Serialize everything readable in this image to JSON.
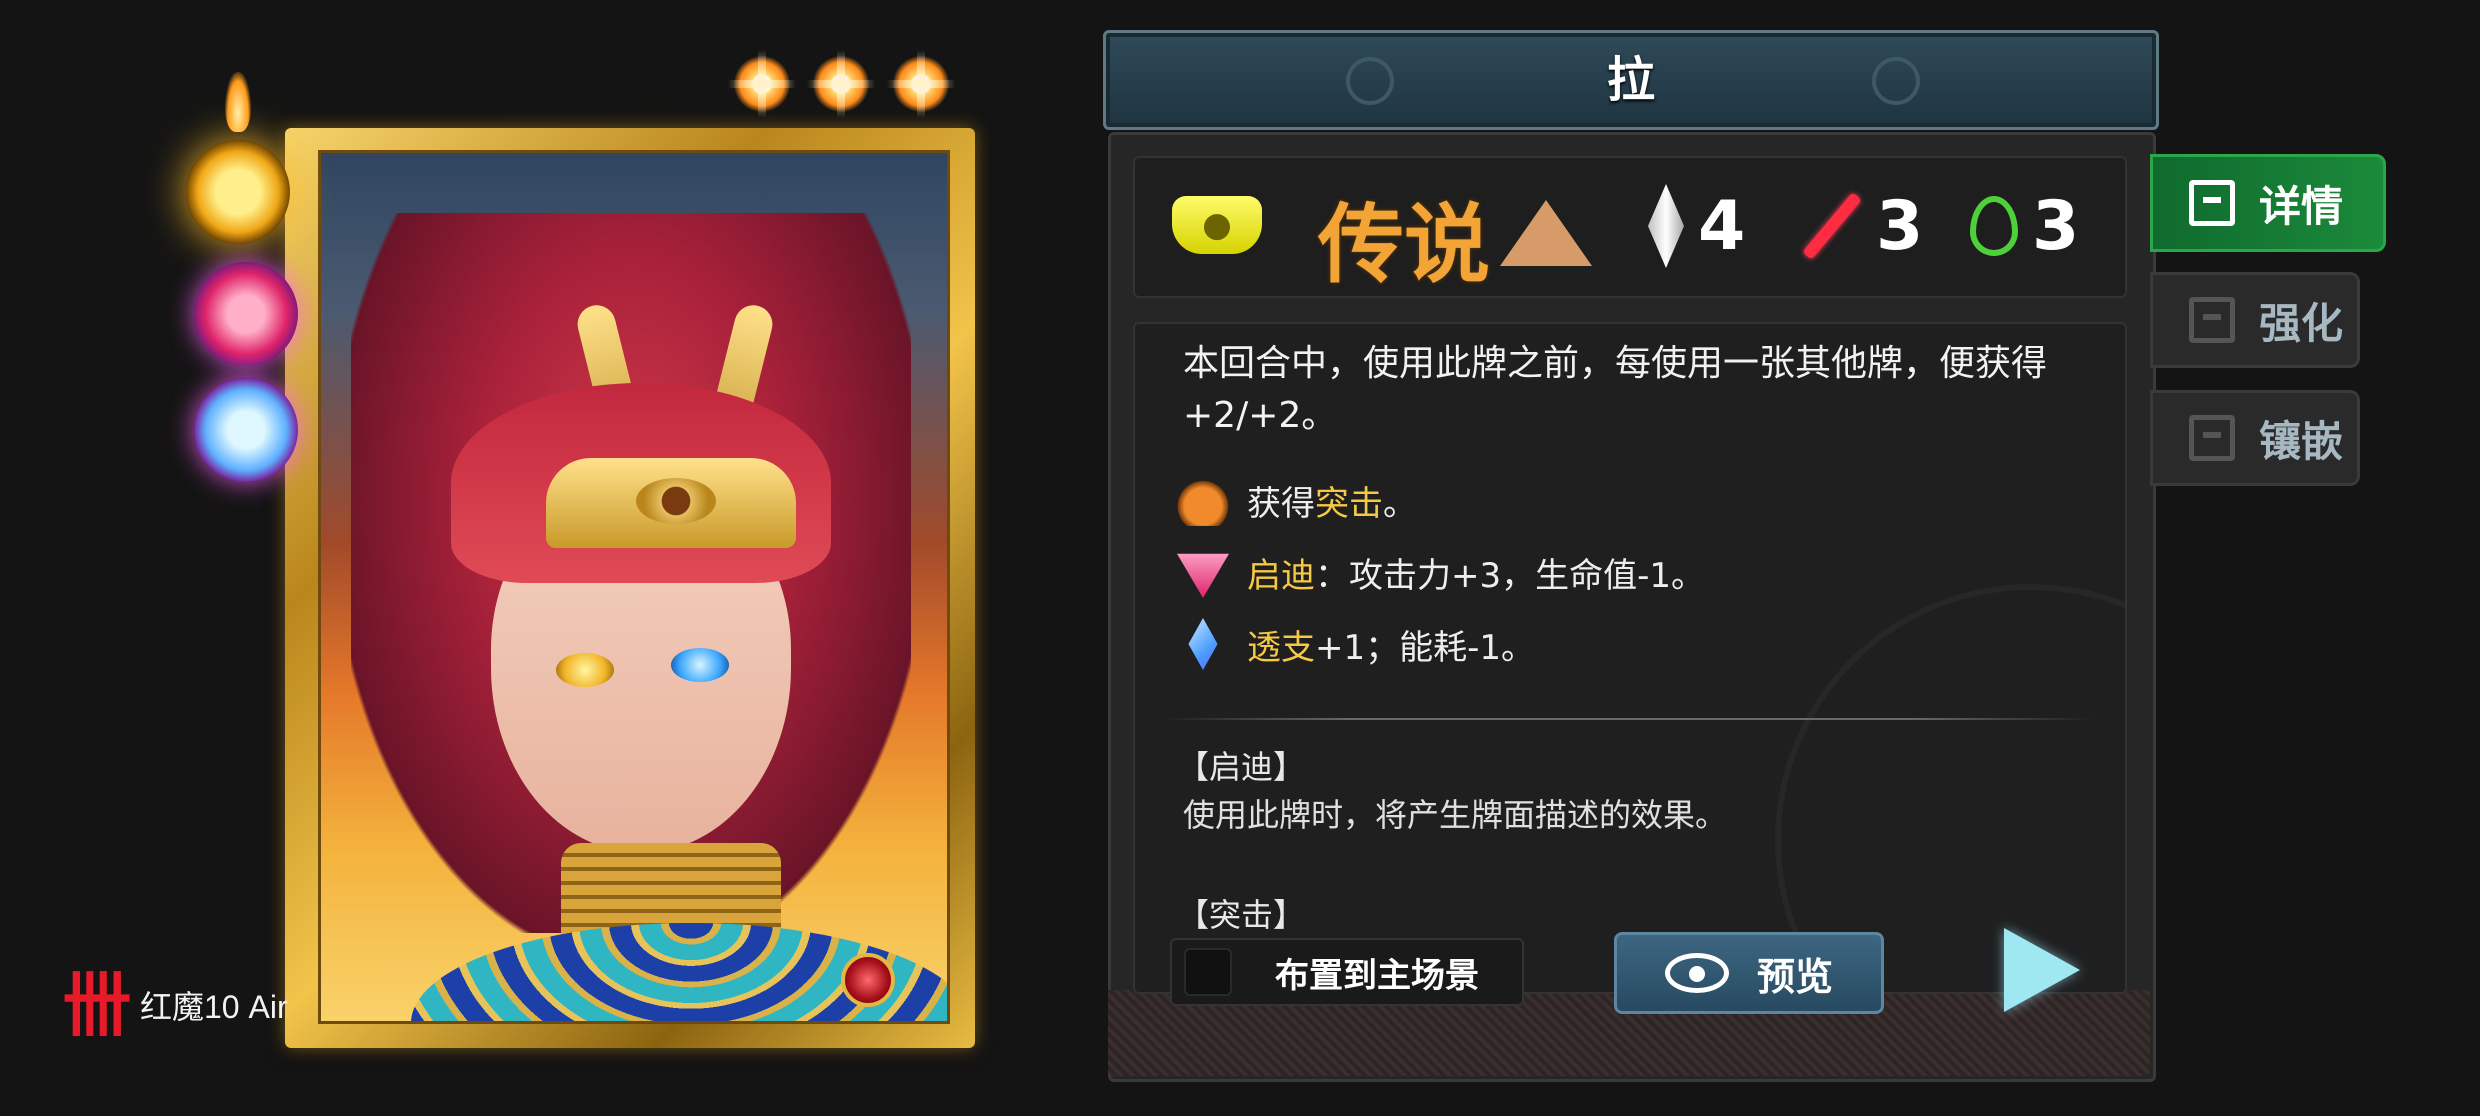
{
  "card": {
    "star_count": 3,
    "gem_slots": [
      "potion",
      "ruby",
      "diamond"
    ]
  },
  "brand": {
    "logo_glyph": "卌",
    "text": "红魔10 Air"
  },
  "header": {
    "title": "拉"
  },
  "stats": {
    "rarity": "传说",
    "crystal_cost": "4",
    "attack": "3",
    "energy": "3"
  },
  "description": {
    "main": "本回合中，使用此牌之前，每使用一张其他牌，便获得+2/+2。",
    "effects": [
      {
        "icon": "potion-icon",
        "pre": "获得",
        "keyword": "突击",
        "post": "。"
      },
      {
        "icon": "ruby-icon",
        "pre": "",
        "keyword": "启迪",
        "post": "：攻击力+3，生命值-1。"
      },
      {
        "icon": "diamond-icon",
        "pre": "",
        "keyword": "透支",
        "post": "+1；能耗-1。"
      }
    ],
    "keywords": [
      {
        "title": "【启迪】",
        "desc": "使用此牌时，将产生牌面描述的效果。"
      },
      {
        "title": "【突击】",
        "desc": ""
      }
    ]
  },
  "actions": {
    "place_label": "布置到主场景",
    "preview_label": "预览"
  },
  "tabs": [
    {
      "label": "详情",
      "active": true
    },
    {
      "label": "强化",
      "active": false
    },
    {
      "label": "镶嵌",
      "active": false
    }
  ],
  "colors": {
    "rarity": "#f2a436",
    "keyword_highlight": "#f6c945",
    "active_tab": "#1b8a3a",
    "play_button": "#9fe8f2"
  }
}
